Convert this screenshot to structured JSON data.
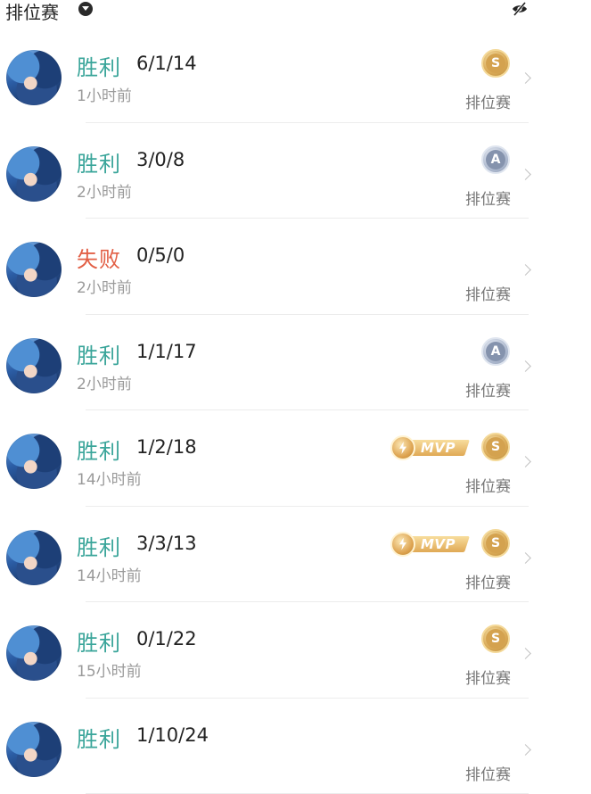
{
  "header": {
    "title": "排位赛",
    "filter_icon": "chevron-down-circle-icon",
    "visibility_icon": "eye-off-icon"
  },
  "colors": {
    "win": "#3aa59a",
    "lose": "#e25f45",
    "gold": "#d9a956",
    "silver": "#8593ad"
  },
  "matches": [
    {
      "result": "胜利",
      "outcome": "win",
      "kda": "6/1/14",
      "time": "1小时前",
      "mode": "排位赛",
      "medal": "S",
      "medal_type": "gold",
      "mvp": false
    },
    {
      "result": "胜利",
      "outcome": "win",
      "kda": "3/0/8",
      "time": "2小时前",
      "mode": "排位赛",
      "medal": "A",
      "medal_type": "silver",
      "mvp": false
    },
    {
      "result": "失败",
      "outcome": "lose",
      "kda": "0/5/0",
      "time": "2小时前",
      "mode": "排位赛",
      "medal": null,
      "medal_type": null,
      "mvp": false
    },
    {
      "result": "胜利",
      "outcome": "win",
      "kda": "1/1/17",
      "time": "2小时前",
      "mode": "排位赛",
      "medal": "A",
      "medal_type": "silver",
      "mvp": false
    },
    {
      "result": "胜利",
      "outcome": "win",
      "kda": "1/2/18",
      "time": "14小时前",
      "mode": "排位赛",
      "medal": "S",
      "medal_type": "gold",
      "mvp": true,
      "mvp_label": "MVP"
    },
    {
      "result": "胜利",
      "outcome": "win",
      "kda": "3/3/13",
      "time": "14小时前",
      "mode": "排位赛",
      "medal": "S",
      "medal_type": "gold",
      "mvp": true,
      "mvp_label": "MVP"
    },
    {
      "result": "胜利",
      "outcome": "win",
      "kda": "0/1/22",
      "time": "15小时前",
      "mode": "排位赛",
      "medal": "S",
      "medal_type": "gold",
      "mvp": false
    },
    {
      "result": "胜利",
      "outcome": "win",
      "kda": "1/10/24",
      "time": "",
      "mode": "排位赛",
      "medal": null,
      "medal_type": null,
      "mvp": false
    }
  ]
}
